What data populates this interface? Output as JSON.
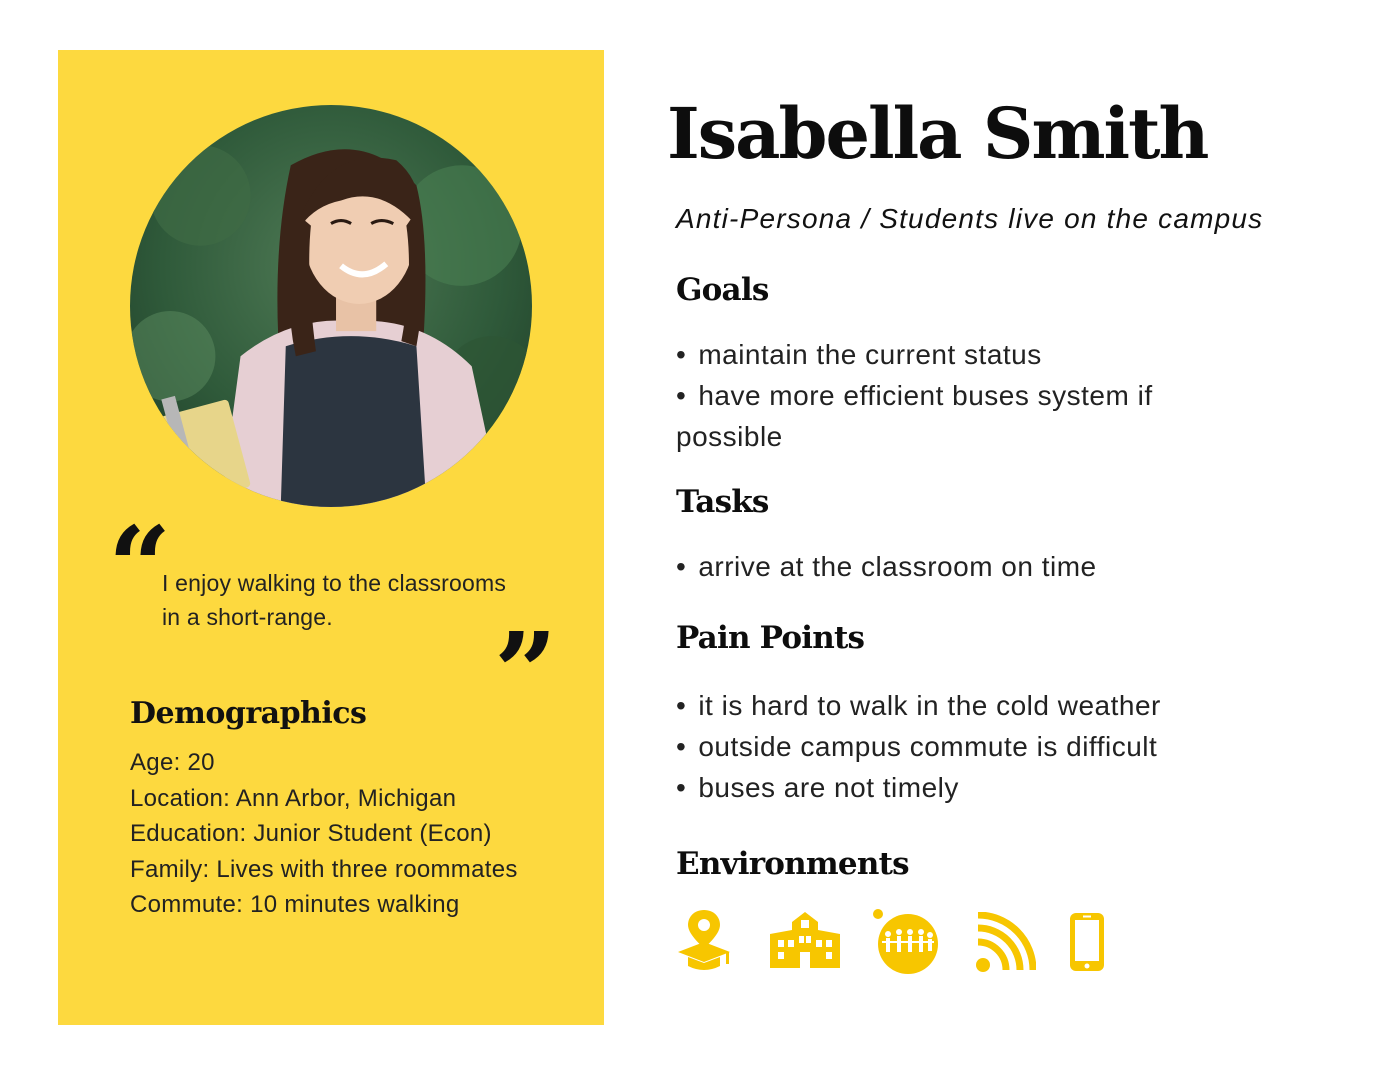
{
  "persona": {
    "name": "Isabella Smith",
    "subtitle": "Anti-Persona / Students live on the campus"
  },
  "quote": {
    "open_mark": "“",
    "text": "I enjoy walking to the classrooms in a short-range.",
    "close_mark": "”"
  },
  "demographics": {
    "heading": "Demographics",
    "items": [
      "Age: 20",
      "Location: Ann Arbor, Michigan",
      "Education: Junior Student (Econ)",
      "Family: Lives with three roommates",
      "Commute: 10 minutes walking"
    ]
  },
  "goals": {
    "heading": "Goals",
    "items": [
      "maintain the current status",
      "have more efficient buses system if possible"
    ]
  },
  "tasks": {
    "heading": "Tasks",
    "items": [
      "arrive at the classroom on time"
    ]
  },
  "pain_points": {
    "heading": "Pain Points",
    "items": [
      "it is hard to walk in the cold weather",
      "outside campus commute is difficult",
      "buses are not timely"
    ]
  },
  "environments": {
    "heading": "Environments",
    "icons": [
      "graduation-location-icon",
      "school-building-icon",
      "community-people-icon",
      "wifi-signal-icon",
      "smartphone-icon"
    ]
  },
  "colors": {
    "accent": "#fdd93f",
    "icon": "#f7c600",
    "text": "#111111"
  }
}
